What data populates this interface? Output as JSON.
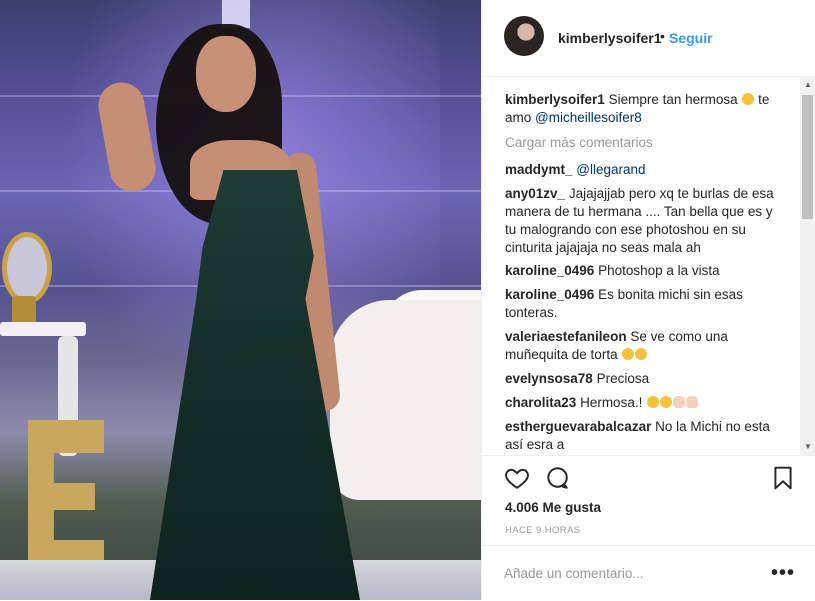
{
  "post": {
    "username": "kimberlysoifer1",
    "separator": "•",
    "follow_label": "Seguir",
    "caption": {
      "username": "kimberlysoifer1",
      "text_before": "Siempre tan hermosa",
      "text_after": "te amo",
      "mention": "@micheillesoifer8"
    },
    "load_more": "Cargar más comentarios",
    "comments": [
      {
        "user": "maddymt_",
        "mention": "@llegarand",
        "text": ""
      },
      {
        "user": "any01zv_",
        "text": "Jajajajjab pero xq te burlas de esa manera de tu hermana .... Tan bella que es y tu malogrando con ese photoshou en su cinturita jajajaja no seas mala ah"
      },
      {
        "user": "karoline_0496",
        "text": "Photoshop a la vista"
      },
      {
        "user": "karoline_0496",
        "text": "Es bonita michi sin esas tonteras."
      },
      {
        "user": "valeriaestefanileon",
        "text": "Se ve como una muñequita de torta"
      },
      {
        "user": "evelynsosa78",
        "text": "Preciosa"
      },
      {
        "user": "charolita23",
        "text": "Hermosa.!"
      },
      {
        "user": "estherguevarabalcazar",
        "text": "No la Michi no esta así esra a"
      }
    ],
    "likes": "4.006 Me gusta",
    "timestamp": "HACE 9 HORAS",
    "add_comment_placeholder": "Añade un comentario...",
    "more_label": "•••"
  },
  "icons": {
    "like": "heart-icon",
    "comment": "comment-bubble-icon",
    "save": "bookmark-icon",
    "options": "more-options-icon"
  },
  "colors": {
    "link_blue": "#3897f0",
    "mention_blue": "#003569",
    "muted_gray": "#999999",
    "text": "#262626"
  }
}
